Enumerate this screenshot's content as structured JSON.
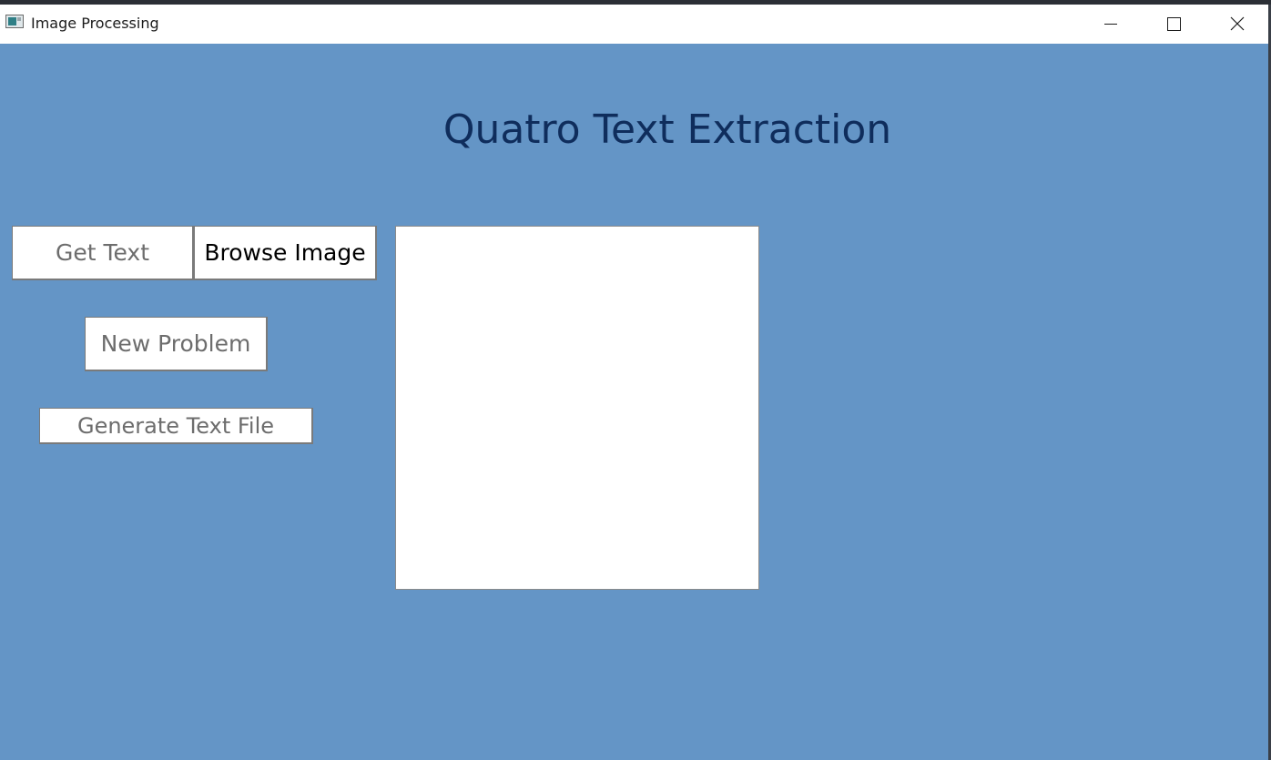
{
  "window": {
    "title": "Image Processing",
    "controls": {
      "minimize_icon": "minimize-icon",
      "maximize_icon": "maximize-icon",
      "close_icon": "close-icon"
    }
  },
  "main": {
    "heading": "Quatro Text Extraction",
    "buttons": {
      "get_text": {
        "label": "Get Text",
        "enabled": false
      },
      "browse_image": {
        "label": "Browse Image",
        "enabled": true
      },
      "new_problem": {
        "label": "New Problem",
        "enabled": false
      },
      "generate_text_file": {
        "label": "Generate Text File",
        "enabled": false
      }
    }
  },
  "colors": {
    "background": "#6495c6",
    "heading": "#0f2d5c",
    "disabled_text": "#6d6d6d",
    "enabled_text": "#000000",
    "panel": "#ffffff"
  }
}
